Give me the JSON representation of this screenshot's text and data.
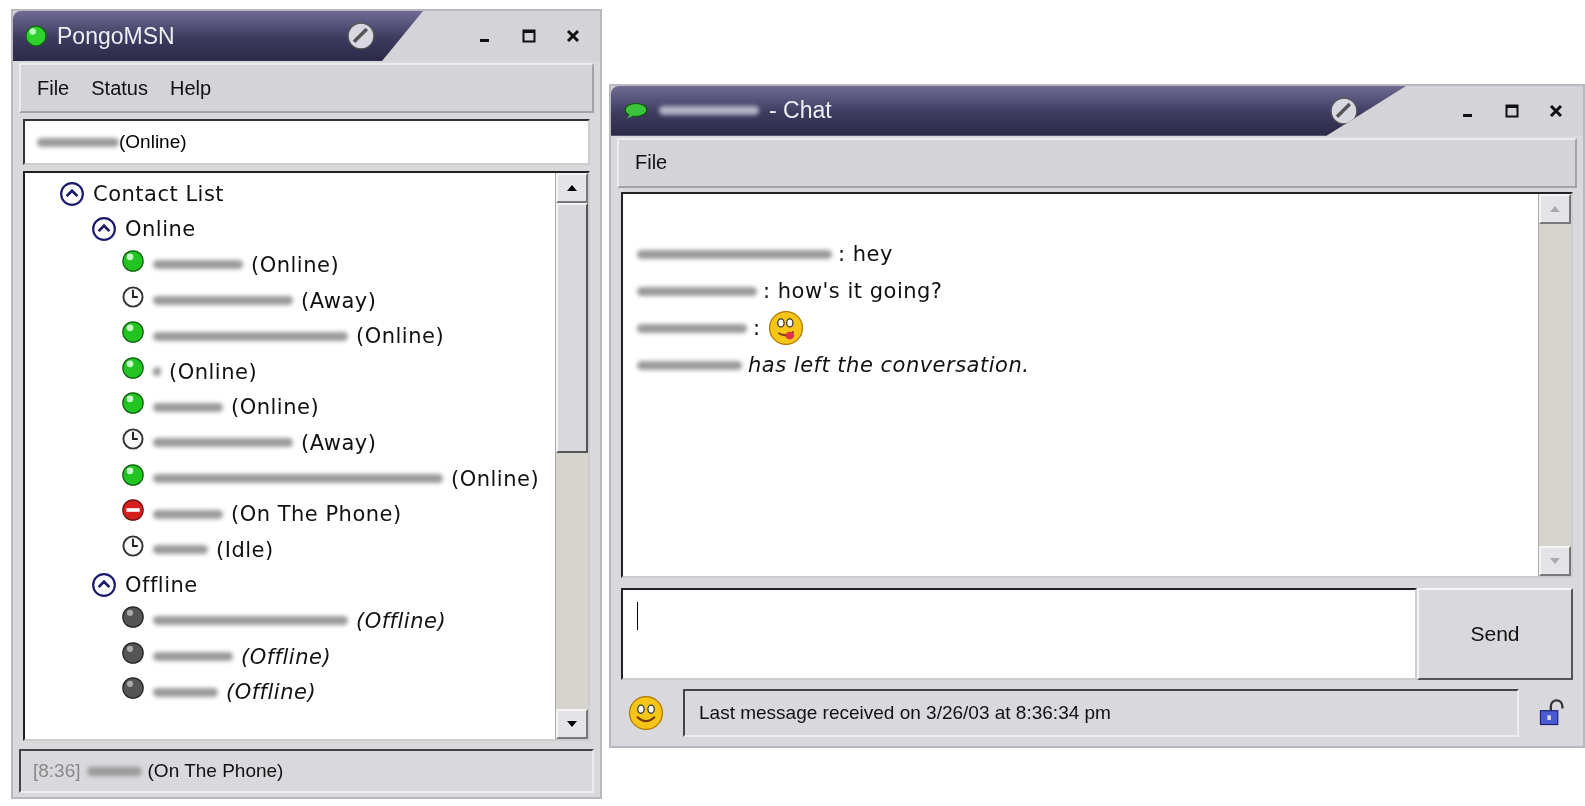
{
  "contact_window": {
    "title": "PongoMSN",
    "menu": [
      "File",
      "Status",
      "Help"
    ],
    "self_status": "(Online)",
    "tree": {
      "label": "Contact List",
      "expanded": true,
      "children": [
        {
          "label": "Online",
          "expanded": true,
          "children": [
            {
              "status": "(Online)",
              "kind": "online"
            },
            {
              "status": "(Away)",
              "kind": "away"
            },
            {
              "status": "(Online)",
              "kind": "online"
            },
            {
              "status": "(Online)",
              "kind": "online"
            },
            {
              "status": "(Online)",
              "kind": "online"
            },
            {
              "status": "(Away)",
              "kind": "away"
            },
            {
              "status": "(Online)",
              "kind": "online"
            },
            {
              "status": "(On The Phone)",
              "kind": "phone"
            },
            {
              "status": "(Idle)",
              "kind": "away"
            }
          ]
        },
        {
          "label": "Offline",
          "expanded": true,
          "children": [
            {
              "status": "(Offline)",
              "kind": "offline"
            },
            {
              "status": "(Offline)",
              "kind": "offline"
            },
            {
              "status": "(Offline)",
              "kind": "offline"
            }
          ]
        }
      ]
    },
    "status_bar": {
      "time": "[8:36]",
      "status": "(On The Phone)"
    }
  },
  "chat_window": {
    "title": "- Chat",
    "menu": [
      "File"
    ],
    "messages": [
      {
        "kind": "text",
        "text": ": hey"
      },
      {
        "kind": "text",
        "text": ": how's it going?"
      },
      {
        "kind": "emoticon",
        "text": ":"
      },
      {
        "kind": "left",
        "text": "has left the conversation."
      }
    ],
    "send_button": "Send",
    "status_bar": "Last message received on 3/26/03 at 8:36:34 pm"
  }
}
